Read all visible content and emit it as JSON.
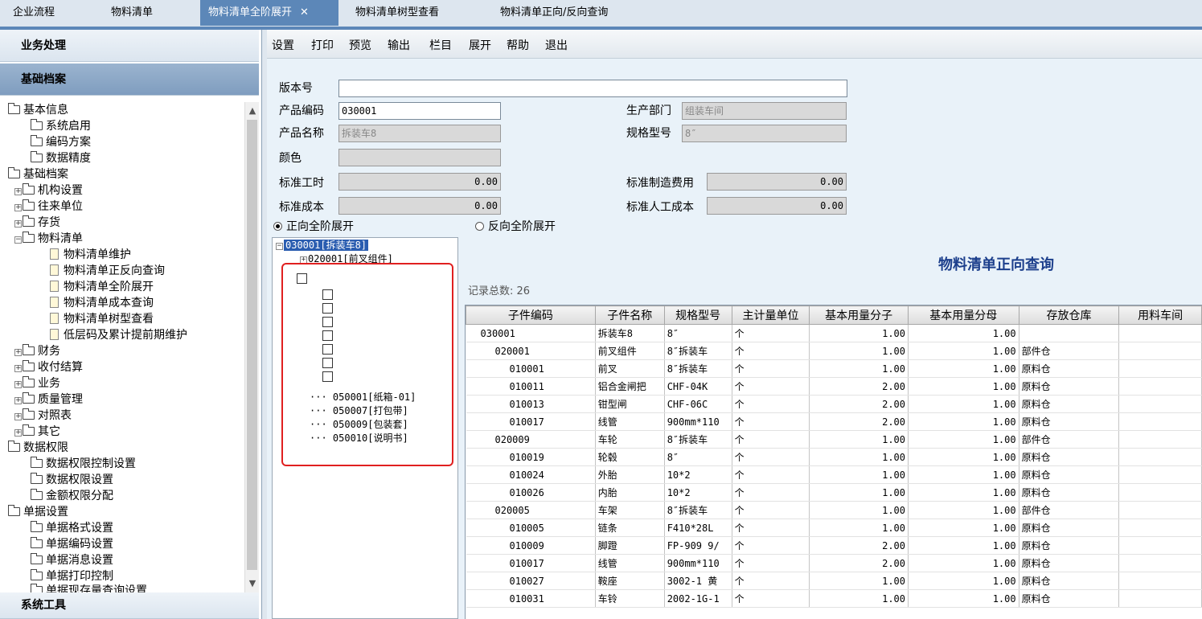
{
  "tabs": [
    {
      "label": "企业流程",
      "active": false
    },
    {
      "label": "物料清单",
      "active": false
    },
    {
      "label": "物料清单全阶展开",
      "active": true
    },
    {
      "label": "物料清单树型查看",
      "active": false
    },
    {
      "label": "物料清单正向/反向查询",
      "active": false
    }
  ],
  "tab_close": "✕",
  "sidebar": {
    "section_business": "业务处理",
    "section_basic": "基础档案",
    "section_tools": "系统工具",
    "tree": [
      {
        "label": "基本信息"
      },
      {
        "label": "系统启用"
      },
      {
        "label": "编码方案"
      },
      {
        "label": "数据精度"
      },
      {
        "label": "基础档案"
      },
      {
        "label": "机构设置"
      },
      {
        "label": "往来单位"
      },
      {
        "label": "存货"
      },
      {
        "label": "物料清单"
      },
      {
        "label": "物料清单维护"
      },
      {
        "label": "物料清单正反向查询"
      },
      {
        "label": "物料清单全阶展开"
      },
      {
        "label": "物料清单成本查询"
      },
      {
        "label": "物料清单树型查看"
      },
      {
        "label": "低层码及累计提前期维护"
      },
      {
        "label": "财务"
      },
      {
        "label": "收付结算"
      },
      {
        "label": "业务"
      },
      {
        "label": "质量管理"
      },
      {
        "label": "对照表"
      },
      {
        "label": "其它"
      },
      {
        "label": "数据权限"
      },
      {
        "label": "数据权限控制设置"
      },
      {
        "label": "数据权限设置"
      },
      {
        "label": "金额权限分配"
      },
      {
        "label": "单据设置"
      },
      {
        "label": "单据格式设置"
      },
      {
        "label": "单据编码设置"
      },
      {
        "label": "单据消息设置"
      },
      {
        "label": "单据打印控制"
      },
      {
        "label": "单据现存量查询设置"
      }
    ]
  },
  "toolbar": {
    "settings": "设置",
    "print": "打印",
    "preview": "预览",
    "output": "输出",
    "columns": "栏目",
    "expand": "展开",
    "help": "帮助",
    "exit": "退出"
  },
  "form": {
    "version_label": "版本号",
    "version_value": "",
    "product_code_label": "产品编码",
    "product_code_value": "030001",
    "product_name_label": "产品名称",
    "product_name_value": "拆装车8",
    "color_label": "颜色",
    "color_value": "",
    "std_hours_label": "标准工时",
    "std_hours_value": "0.00",
    "std_cost_label": "标准成本",
    "std_cost_value": "0.00",
    "dept_label": "生产部门",
    "dept_value": "组装车间",
    "spec_label": "规格型号",
    "spec_value": "8″",
    "std_mfg_label": "标准制造费用",
    "std_mfg_value": "0.00",
    "std_labor_label": "标准人工成本",
    "std_labor_value": "0.00",
    "radio_forward": "正向全阶展开",
    "radio_reverse": "反向全阶展开"
  },
  "bom_tree": {
    "root": "030001[拆装车8]",
    "child1": "020001[前叉组件]",
    "leaves": [
      "050001[纸箱-01]",
      "050007[打包带]",
      "050009[包装套]",
      "050010[说明书]"
    ]
  },
  "report": {
    "title": "物料清单正向查询",
    "count_label": "记录总数: 26",
    "columns": [
      "子件编码",
      "子件名称",
      "规格型号",
      "主计量单位",
      "基本用量分子",
      "基本用量分母",
      "存放仓库",
      "用料车间"
    ],
    "rows": [
      [
        "030001",
        "拆装车8",
        "8″",
        "个",
        "1.00",
        "1.00",
        "",
        ""
      ],
      [
        "020001",
        "前叉组件",
        "8″拆装车",
        "个",
        "1.00",
        "1.00",
        "部件仓",
        ""
      ],
      [
        "010001",
        "前叉",
        "8″拆装车",
        "个",
        "1.00",
        "1.00",
        "原料仓",
        ""
      ],
      [
        "010011",
        "铝合金闸把",
        "CHF-04K",
        "个",
        "2.00",
        "1.00",
        "原料仓",
        ""
      ],
      [
        "010013",
        "钳型闸",
        "CHF-06C",
        "个",
        "2.00",
        "1.00",
        "原料仓",
        ""
      ],
      [
        "010017",
        "线管",
        "900mm*110",
        "个",
        "2.00",
        "1.00",
        "原料仓",
        ""
      ],
      [
        "020009",
        "车轮",
        "8″拆装车",
        "个",
        "1.00",
        "1.00",
        "部件仓",
        ""
      ],
      [
        "010019",
        "轮毂",
        "8″",
        "个",
        "1.00",
        "1.00",
        "原料仓",
        ""
      ],
      [
        "010024",
        "外胎",
        "10*2",
        "个",
        "1.00",
        "1.00",
        "原料仓",
        ""
      ],
      [
        "010026",
        "内胎",
        "10*2",
        "个",
        "1.00",
        "1.00",
        "原料仓",
        ""
      ],
      [
        "020005",
        "车架",
        "8″拆装车",
        "个",
        "1.00",
        "1.00",
        "部件仓",
        ""
      ],
      [
        "010005",
        "链条",
        "F410*28L",
        "个",
        "1.00",
        "1.00",
        "原料仓",
        ""
      ],
      [
        "010009",
        "脚蹬",
        "FP-909 9/",
        "个",
        "2.00",
        "1.00",
        "原料仓",
        ""
      ],
      [
        "010017",
        "线管",
        "900mm*110",
        "个",
        "2.00",
        "1.00",
        "原料仓",
        ""
      ],
      [
        "010027",
        "鞍座",
        "3002-1 黄",
        "个",
        "1.00",
        "1.00",
        "原料仓",
        ""
      ],
      [
        "010031",
        "车铃",
        "2002-1G-1",
        "个",
        "1.00",
        "1.00",
        "原料仓",
        ""
      ]
    ]
  }
}
